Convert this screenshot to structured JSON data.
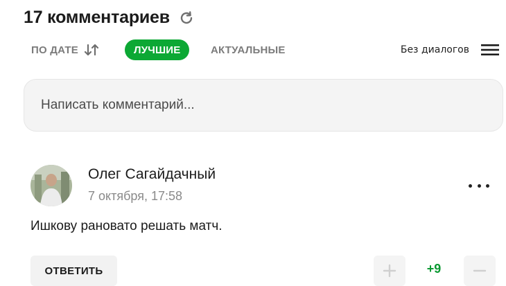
{
  "header": {
    "title": "17 комментариев",
    "refresh_icon": "refresh-icon"
  },
  "sort": {
    "by_date": "ПО ДАТЕ",
    "best": "ЛУЧШИЕ",
    "actual": "АКТУАЛЬНЫЕ",
    "active": "best",
    "accent_color": "#0ca834"
  },
  "view": {
    "dialog_mode": "Без диалогов",
    "menu_icon": "hamburger-icon"
  },
  "compose": {
    "placeholder": "Написать комментарий..."
  },
  "comment": {
    "author": "Олег Сагайдачный",
    "timestamp": "7 октября, 17:58",
    "text": "Ишкову рановато решать матч.",
    "reply_label": "ОТВЕТИТЬ",
    "score": "+9",
    "score_color": "#0c9a33"
  }
}
